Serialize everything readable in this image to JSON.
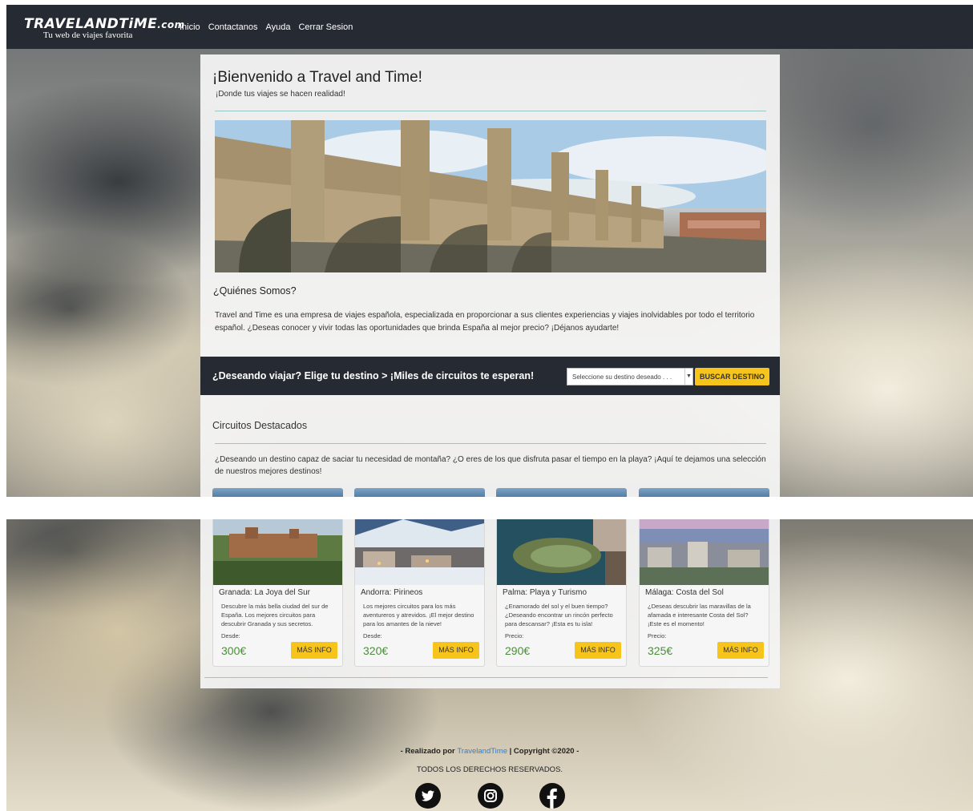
{
  "brand": {
    "name": "TRAVELANDTiME",
    "suffix": ".com",
    "tagline": "Tu web de viajes favorita"
  },
  "nav": [
    "Inicio",
    "Contactanos",
    "Ayuda",
    "Cerrar Sesion"
  ],
  "welcome": {
    "title": "¡Bienvenido a Travel and Time!",
    "subtitle": "¡Donde tus viajes se hacen realidad!"
  },
  "about": {
    "title": "¿Quiénes Somos?",
    "text": "Travel and Time es una empresa de viajes española, especializada en proporcionar a sus clientes experiencias y viajes inolvidables por todo el territorio español. ¿Deseas conocer y vivir todas las oportunidades que brinda España al mejor precio? ¡Déjanos ayudarte!"
  },
  "search": {
    "question": "¿Deseando viajar? Elige tu destino > ¡Miles de circuitos te esperan!",
    "select_value": "Seleccione su destino deseado . . .",
    "button": "BUSCAR DESTINO"
  },
  "featured": {
    "title": "Circuitos Destacados",
    "text": "¿Deseando un destino capaz de saciar tu necesidad de montaña? ¿O eres de los que disfruta pasar el tiempo en la playa? ¡Aquí te dejamos una selección de nuestros mejores destinos!"
  },
  "cards": [
    {
      "title": "Granada: La Joya del Sur",
      "desc": "Descubre la más bella ciudad del sur de España. Los mejores circuitos para descubrir Granada y sus secretos.",
      "from": "Desde:",
      "price": "300€",
      "button": "MÁS INFO"
    },
    {
      "title": "Andorra: Pirineos",
      "desc": "Los mejores circuitos para los más aventureros y atrevidos. ¡El mejor destino para los amantes de la nieve!",
      "from": "Desde:",
      "price": "320€",
      "button": "MÁS INFO"
    },
    {
      "title": "Palma: Playa y Turismo",
      "desc": "¿Enamorado del sol y el buen tiempo? ¿Deseando encontrar un rincón perfecto para descansar? ¡Esta es tu isla!",
      "from": "Precio:",
      "price": "290€",
      "button": "MÁS INFO"
    },
    {
      "title": "Málaga: Costa del Sol",
      "desc": "¿Deseas descubrir las maravillas de la afamada e interesante Costa del Sol? ¡Este es el momento!",
      "from": "Precio:",
      "price": "325€",
      "button": "MÁS INFO"
    }
  ],
  "footer": {
    "prefix": "- Realizado por ",
    "link": "TravelandTime",
    "suffix": " | Copyright ©2020 -",
    "rights": "TODOS LOS DERECHOS RESERVADOS."
  },
  "icons": [
    "twitter-icon",
    "instagram-icon",
    "facebook-icon"
  ]
}
